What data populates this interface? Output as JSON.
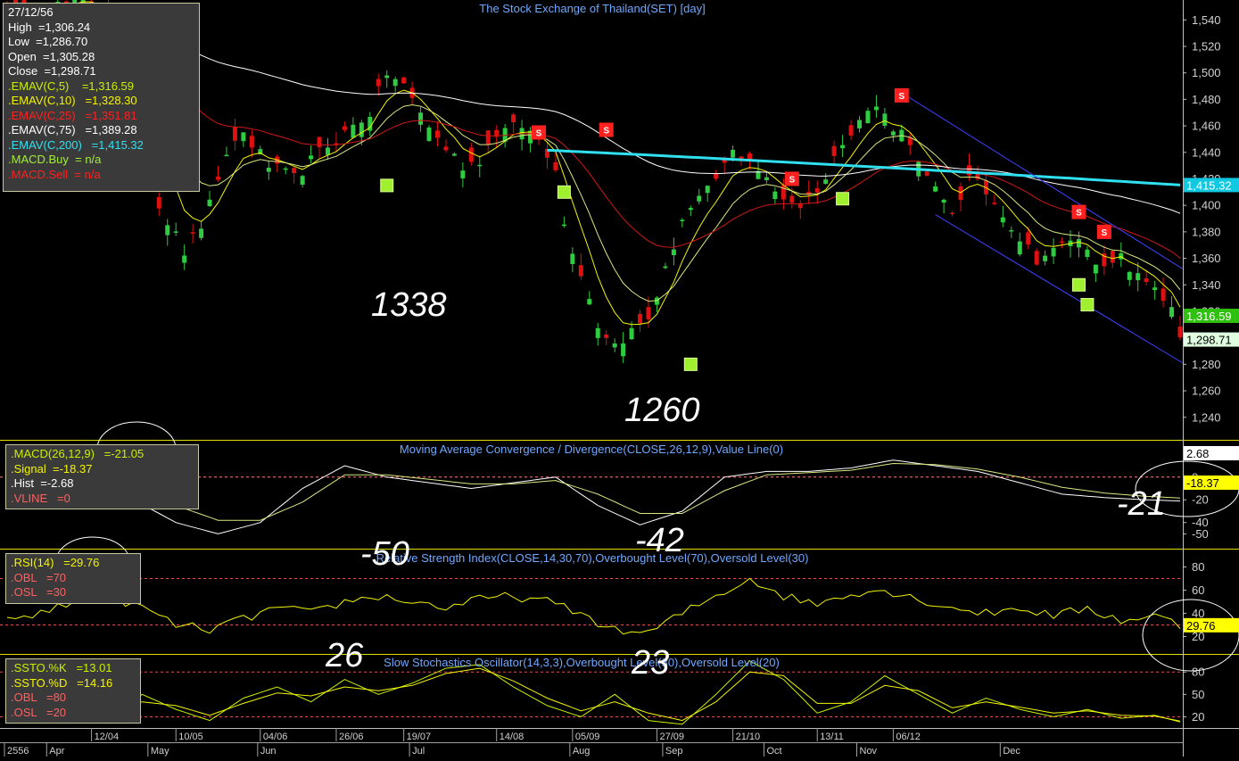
{
  "main_title": "The Stock Exchange of Thailand(SET) [day]",
  "main_info": {
    "date": "27/12/56",
    "high": "High  =1,306.24",
    "low": "Low  =1,286.70",
    "open": "Open  =1,305.28",
    "close": "Close  =1,298.71",
    "ema5": ".EMAV(C,5)    =1,316.59",
    "ema10": ".EMAV(C,10)   =1,328.30",
    "ema25": ".EMAV(C,25)   =1,351.81",
    "ema75": ".EMAV(C,75)   =1,389.28",
    "ema200": ".EMAV(C,200)   =1,415.32",
    "macd_buy": ".MACD.Buy  = n/a",
    "macd_sell": ".MACD.Sell  = n/a"
  },
  "macd_info": {
    "title": "Moving Average Convergence / Divergence(CLOSE,26,12,9),Value Line(0)",
    "macd": ".MACD(26,12,9)   =-21.05",
    "signal": ".Signal  =-18.37",
    "hist": ".Hist  =-2.68",
    "vline": ".VLINE   =0"
  },
  "rsi_info": {
    "title": "Relative Strength Index(CLOSE,14,30,70),Overbought Level(70),Oversold Level(30)",
    "rsi": ".RSI(14)   =29.76",
    "obl": ".OBL   =70",
    "osl": ".OSL   =30"
  },
  "sto_info": {
    "title": "Slow Stochastics Oscillator(14,3,3),Overbought Level(80),Oversold Level(20)",
    "k": ".SSTO.%K   =13.01",
    "d": ".SSTO.%D   =14.16",
    "obl": ".OBL   =80",
    "osl": ".OSL   =20"
  },
  "annotations": {
    "a1338": "1338",
    "a1260": "1260",
    "m50": "-50",
    "m42": "-42",
    "m21": "-21",
    "r26": "26",
    "r23": "23"
  },
  "value_tags": {
    "ema200": "1,415.32",
    "ema5": "1,316.59",
    "close": "1,298.71",
    "hist": "2.68",
    "signal": "-18.37",
    "rsi": "29.76"
  },
  "colors": {
    "up": "#2ecc40",
    "down": "#e01010",
    "ema5": "#f4f400",
    "ema10": "#d8e880",
    "ema25": "#d01818",
    "ema75": "#ffffff",
    "ema200": "#30e0f0",
    "panel_border": "#e0e000",
    "axis_text": "#d0d0d0",
    "title": "#6fa8ff",
    "buy": "#a0f030",
    "sell": "#ff2020"
  },
  "sell_marker_label": "S",
  "chart_data": [
    {
      "type": "candlestick",
      "title": "The Stock Exchange of Thailand(SET) [day]",
      "y_ticks": [
        1540,
        1520,
        1500,
        1480,
        1460,
        1440,
        1420,
        1400,
        1380,
        1360,
        1340,
        1320,
        1300,
        1280,
        1260,
        1240
      ],
      "ylim": [
        1223,
        1555
      ],
      "x_ticks": [
        "12/04",
        "10/05",
        "04/06",
        "26/06",
        "19/07",
        "14/08",
        "05/09",
        "27/09",
        "21/10",
        "13/11",
        "06/12"
      ],
      "months": [
        "2556",
        "Apr",
        "May",
        "Jun",
        "Jul",
        "Aug",
        "Sep",
        "Oct",
        "Nov",
        "Dec"
      ],
      "close_path": [
        [
          0,
          1545
        ],
        [
          10,
          1555
        ],
        [
          12,
          1540
        ],
        [
          14,
          1520
        ],
        [
          16,
          1470
        ],
        [
          18,
          1400
        ],
        [
          21,
          1365
        ],
        [
          23,
          1385
        ],
        [
          25,
          1415
        ],
        [
          26,
          1440
        ],
        [
          28,
          1455
        ],
        [
          31,
          1430
        ],
        [
          34,
          1420
        ],
        [
          37,
          1440
        ],
        [
          40,
          1455
        ],
        [
          43,
          1470
        ],
        [
          45,
          1500
        ],
        [
          47,
          1490
        ],
        [
          49,
          1470
        ],
        [
          51,
          1450
        ],
        [
          54,
          1430
        ],
        [
          56,
          1435
        ],
        [
          58,
          1455
        ],
        [
          61,
          1460
        ],
        [
          63,
          1450
        ],
        [
          65,
          1430
        ],
        [
          66,
          1385
        ],
        [
          68,
          1350
        ],
        [
          70,
          1310
        ],
        [
          72,
          1295
        ],
        [
          74,
          1305
        ],
        [
          76,
          1315
        ],
        [
          78,
          1350
        ],
        [
          80,
          1390
        ],
        [
          83,
          1410
        ],
        [
          86,
          1440
        ],
        [
          88,
          1435
        ],
        [
          91,
          1410
        ],
        [
          94,
          1400
        ],
        [
          97,
          1420
        ],
        [
          99,
          1450
        ],
        [
          101,
          1465
        ],
        [
          103,
          1475
        ],
        [
          105,
          1460
        ],
        [
          107,
          1450
        ],
        [
          108,
          1430
        ],
        [
          110,
          1410
        ],
        [
          112,
          1395
        ],
        [
          114,
          1420
        ],
        [
          116,
          1410
        ],
        [
          118,
          1395
        ],
        [
          120,
          1375
        ],
        [
          122,
          1360
        ],
        [
          124,
          1365
        ],
        [
          126,
          1375
        ],
        [
          128,
          1370
        ],
        [
          130,
          1350
        ],
        [
          132,
          1360
        ],
        [
          134,
          1345
        ],
        [
          136,
          1340
        ],
        [
          138,
          1320
        ],
        [
          139,
          1299
        ]
      ],
      "ema_series": [
        {
          "name": ".EMAV(C,5)",
          "last": 1316.59
        },
        {
          "name": ".EMAV(C,10)",
          "last": 1328.3
        },
        {
          "name": ".EMAV(C,25)",
          "last": 1351.81
        },
        {
          "name": ".EMAV(C,75)",
          "last": 1389.28
        },
        {
          "name": ".EMAV(C,200)",
          "last": 1415.32
        }
      ],
      "buy_signals": [
        [
          45,
          1415
        ],
        [
          66,
          1410
        ],
        [
          81,
          1280
        ],
        [
          99,
          1405
        ],
        [
          127,
          1340
        ],
        [
          128,
          1325
        ]
      ],
      "sell_signals": [
        [
          63,
          1455
        ],
        [
          71,
          1457
        ],
        [
          93,
          1420
        ],
        [
          106,
          1483
        ],
        [
          127,
          1395
        ],
        [
          130,
          1380
        ]
      ],
      "annotations": [
        "1338",
        "1260"
      ]
    },
    {
      "type": "line",
      "title": "Moving Average Convergence / Divergence(CLOSE,26,12,9),Value Line(0)",
      "y_ticks": [
        20,
        0,
        -20,
        -40,
        -50
      ],
      "ylim": [
        -63,
        32
      ],
      "series": [
        {
          "name": ".MACD(26,12,9)",
          "points": [
            [
              0,
              25
            ],
            [
              5,
              10
            ],
            [
              10,
              -5
            ],
            [
              15,
              -20
            ],
            [
              20,
              -40
            ],
            [
              25,
              -50
            ],
            [
              30,
              -40
            ],
            [
              35,
              -10
            ],
            [
              40,
              10
            ],
            [
              45,
              0
            ],
            [
              50,
              -5
            ],
            [
              55,
              -10
            ],
            [
              60,
              -5
            ],
            [
              65,
              0
            ],
            [
              70,
              -25
            ],
            [
              75,
              -42
            ],
            [
              80,
              -30
            ],
            [
              85,
              0
            ],
            [
              90,
              5
            ],
            [
              95,
              5
            ],
            [
              100,
              8
            ],
            [
              105,
              15
            ],
            [
              110,
              10
            ],
            [
              115,
              5
            ],
            [
              120,
              -5
            ],
            [
              125,
              -15
            ],
            [
              130,
              -18
            ],
            [
              135,
              -20
            ],
            [
              139,
              -21
            ]
          ]
        },
        {
          "name": ".Signal",
          "points": [
            [
              0,
              28
            ],
            [
              5,
              18
            ],
            [
              10,
              5
            ],
            [
              15,
              -8
            ],
            [
              20,
              -25
            ],
            [
              25,
              -38
            ],
            [
              30,
              -38
            ],
            [
              35,
              -22
            ],
            [
              40,
              2
            ],
            [
              45,
              2
            ],
            [
              50,
              -2
            ],
            [
              55,
              -6
            ],
            [
              60,
              -6
            ],
            [
              65,
              -3
            ],
            [
              70,
              -15
            ],
            [
              75,
              -32
            ],
            [
              80,
              -32
            ],
            [
              85,
              -12
            ],
            [
              90,
              2
            ],
            [
              95,
              4
            ],
            [
              100,
              6
            ],
            [
              105,
              12
            ],
            [
              110,
              11
            ],
            [
              115,
              7
            ],
            [
              120,
              0
            ],
            [
              125,
              -9
            ],
            [
              130,
              -14
            ],
            [
              135,
              -17
            ],
            [
              139,
              -18.37
            ]
          ]
        }
      ],
      "annotations": [
        "-50",
        "-42",
        "-21"
      ]
    },
    {
      "type": "line",
      "title": "Relative Strength Index(CLOSE,14,30,70),Overbought Level(70),Oversold Level(30)",
      "y_ticks": [
        80,
        60,
        40,
        20
      ],
      "ylim": [
        5,
        95
      ],
      "levels": [
        70,
        30
      ],
      "series": [
        {
          "name": ".RSI(14)",
          "points": [
            [
              0,
              35
            ],
            [
              4,
              40
            ],
            [
              8,
              50
            ],
            [
              12,
              55
            ],
            [
              16,
              45
            ],
            [
              20,
              30
            ],
            [
              24,
              26
            ],
            [
              28,
              35
            ],
            [
              32,
              45
            ],
            [
              36,
              40
            ],
            [
              40,
              50
            ],
            [
              44,
              55
            ],
            [
              48,
              50
            ],
            [
              52,
              45
            ],
            [
              56,
              52
            ],
            [
              60,
              55
            ],
            [
              64,
              50
            ],
            [
              68,
              40
            ],
            [
              72,
              25
            ],
            [
              76,
              23
            ],
            [
              80,
              40
            ],
            [
              84,
              55
            ],
            [
              88,
              70
            ],
            [
              92,
              55
            ],
            [
              96,
              48
            ],
            [
              100,
              58
            ],
            [
              104,
              60
            ],
            [
              108,
              52
            ],
            [
              112,
              45
            ],
            [
              116,
              40
            ],
            [
              120,
              45
            ],
            [
              124,
              38
            ],
            [
              128,
              44
            ],
            [
              132,
              34
            ],
            [
              136,
              38
            ],
            [
              139,
              29.76
            ]
          ]
        }
      ],
      "annotations": [
        "26",
        "23"
      ]
    },
    {
      "type": "line",
      "title": "Slow Stochastics Oscillator(14,3,3),Overbought Level(80),Oversold Level(20)",
      "y_ticks": [
        80,
        50,
        20
      ],
      "ylim": [
        5,
        103
      ],
      "levels": [
        80,
        20
      ],
      "series": [
        {
          "name": ".SSTO.%K",
          "points": [
            [
              0,
              80
            ],
            [
              4,
              60
            ],
            [
              8,
              35
            ],
            [
              12,
              20
            ],
            [
              16,
              50
            ],
            [
              20,
              30
            ],
            [
              24,
              15
            ],
            [
              28,
              45
            ],
            [
              32,
              60
            ],
            [
              36,
              40
            ],
            [
              40,
              70
            ],
            [
              44,
              50
            ],
            [
              48,
              65
            ],
            [
              52,
              85
            ],
            [
              56,
              90
            ],
            [
              60,
              60
            ],
            [
              64,
              35
            ],
            [
              68,
              20
            ],
            [
              72,
              50
            ],
            [
              76,
              15
            ],
            [
              80,
              10
            ],
            [
              84,
              50
            ],
            [
              88,
              95
            ],
            [
              92,
              70
            ],
            [
              96,
              25
            ],
            [
              100,
              40
            ],
            [
              104,
              75
            ],
            [
              108,
              50
            ],
            [
              112,
              25
            ],
            [
              116,
              45
            ],
            [
              120,
              30
            ],
            [
              124,
              20
            ],
            [
              128,
              30
            ],
            [
              132,
              18
            ],
            [
              136,
              22
            ],
            [
              139,
              13.01
            ]
          ]
        },
        {
          "name": ".SSTO.%D",
          "points": [
            [
              0,
              75
            ],
            [
              4,
              62
            ],
            [
              8,
              42
            ],
            [
              12,
              28
            ],
            [
              16,
              40
            ],
            [
              20,
              35
            ],
            [
              24,
              22
            ],
            [
              28,
              38
            ],
            [
              32,
              52
            ],
            [
              36,
              48
            ],
            [
              40,
              60
            ],
            [
              44,
              55
            ],
            [
              48,
              62
            ],
            [
              52,
              78
            ],
            [
              56,
              85
            ],
            [
              60,
              68
            ],
            [
              64,
              45
            ],
            [
              68,
              28
            ],
            [
              72,
              40
            ],
            [
              76,
              25
            ],
            [
              80,
              15
            ],
            [
              84,
              40
            ],
            [
              88,
              80
            ],
            [
              92,
              75
            ],
            [
              96,
              38
            ],
            [
              100,
              38
            ],
            [
              104,
              62
            ],
            [
              108,
              55
            ],
            [
              112,
              32
            ],
            [
              116,
              40
            ],
            [
              120,
              33
            ],
            [
              124,
              25
            ],
            [
              128,
              28
            ],
            [
              132,
              22
            ],
            [
              136,
              21
            ],
            [
              139,
              14.16
            ]
          ]
        }
      ]
    }
  ]
}
